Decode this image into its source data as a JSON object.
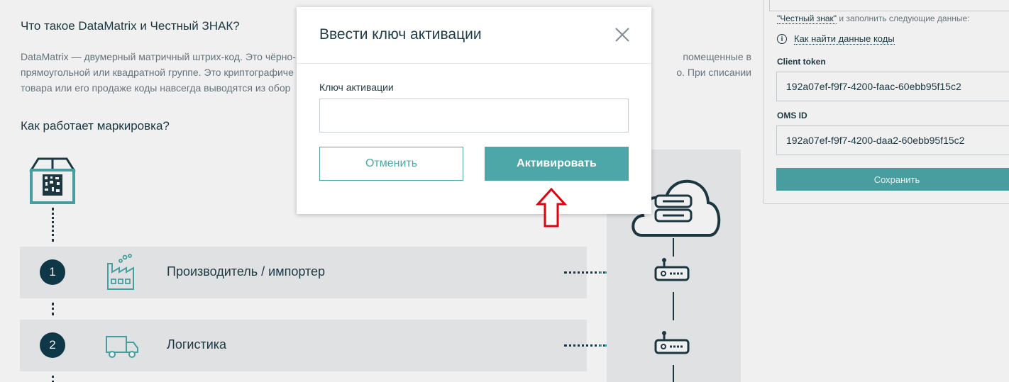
{
  "background": {
    "heading_what": "Что такое DataMatrix и Честный ЗНАК?",
    "paragraph_line1": "DataMatrix — двумерный матричный штрих-код. Это чёрно-",
    "paragraph_line1_end": "помещенные в",
    "paragraph_line2": "прямоугольной или квадратной группе. Это криптографиче",
    "paragraph_line2_end": "о. При списании",
    "paragraph_line3": "товара или его продаже коды навсегда выводятся из обор",
    "heading_how": "Как работает маркировка?",
    "steps": [
      {
        "number": "1",
        "label": "Производитель / импортер",
        "icon": "factory-icon"
      },
      {
        "number": "2",
        "label": "Логистика",
        "icon": "truck-icon"
      }
    ]
  },
  "panel": {
    "note_strong": "\"Честный знак\"",
    "note_rest": " и заполнить следующие данные:",
    "help_link": "Как найти данные коды",
    "client_token_label": "Client token",
    "client_token_value": "192a07ef-f9f7-4200-faac-60ebb95f15c2",
    "oms_id_label": "OMS ID",
    "oms_id_value": "192a07ef-f9f7-4200-daa2-60ebb95f15c2",
    "save_label": "Сохранить"
  },
  "modal": {
    "title": "Ввести ключ активации",
    "field_label": "Ключ активации",
    "field_value": "",
    "cancel_label": "Отменить",
    "activate_label": "Активировать"
  },
  "colors": {
    "accent": "#4da7a8",
    "dark": "#1f3b46",
    "step_badge": "#0f3b4d",
    "arrow": "#e3000f"
  }
}
